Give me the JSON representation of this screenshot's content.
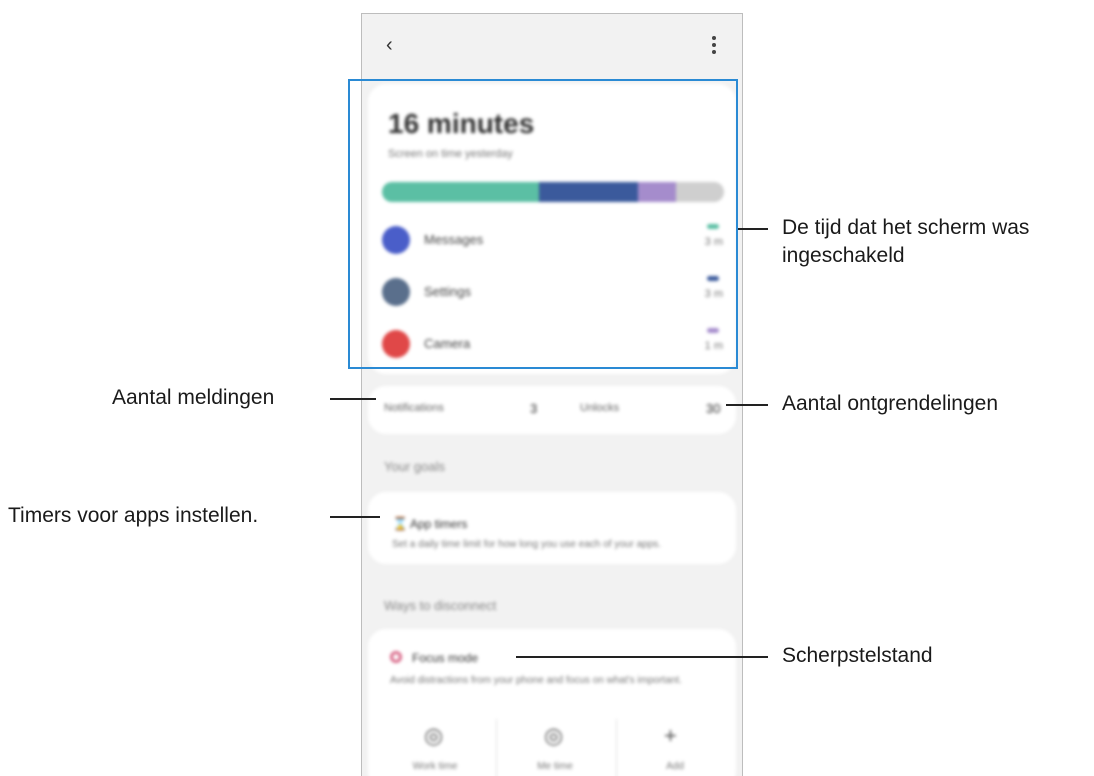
{
  "screen": {
    "time_title": "16 minutes",
    "time_subtitle": "Screen on time yesterday",
    "usage_segments": [
      {
        "color": "#5bbfa4",
        "fraction": 0.46
      },
      {
        "color": "#3b5a9c",
        "fraction": 0.29
      },
      {
        "color": "#a58ccc",
        "fraction": 0.11
      },
      {
        "color": "#cfcfcf",
        "fraction": 0.14
      }
    ],
    "apps": [
      {
        "name": "Messages",
        "time": "3 m",
        "color": "#4a5ec9",
        "bar_color": "#5bbfa4"
      },
      {
        "name": "Settings",
        "time": "3 m",
        "color": "#5a6f8c",
        "bar_color": "#3b5a9c"
      },
      {
        "name": "Camera",
        "time": "1 m",
        "color": "#e04848",
        "bar_color": "#a58ccc"
      }
    ],
    "counts": {
      "notifications_label": "Notifications",
      "notifications_value": "3",
      "unlocks_label": "Unlocks",
      "unlocks_value": "30"
    },
    "goals_header": "Your goals",
    "app_timers": {
      "title": "App timers",
      "desc": "Set a daily time limit for how long you use each of your apps."
    },
    "disconnect_header": "Ways to disconnect",
    "focus_mode": {
      "title": "Focus mode",
      "desc": "Avoid distractions from your phone and focus on what's important."
    },
    "modes": [
      {
        "label": "Work time",
        "glyph": "◎"
      },
      {
        "label": "Me time",
        "glyph": "◎"
      },
      {
        "label": "Add",
        "glyph": "+"
      }
    ]
  },
  "callouts": {
    "screen_time": "De tijd dat het scherm was",
    "screen_time_line2": "ingeschakeld",
    "notifications": "Aantal meldingen",
    "unlocks": "Aantal ontgrendelingen",
    "app_timers": "Timers voor apps instellen.",
    "focus_mode": "Scherpstelstand"
  },
  "colors": {
    "highlight": "#2a8ad4"
  }
}
